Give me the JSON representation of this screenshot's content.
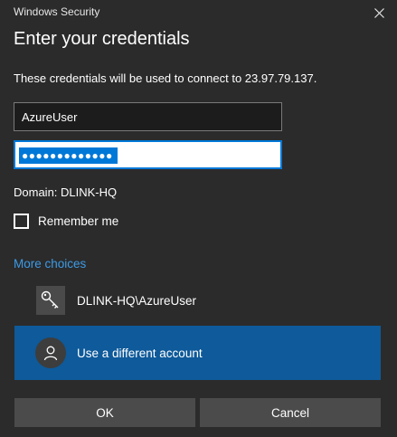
{
  "window": {
    "app_title": "Windows Security",
    "close_glyph": "✕"
  },
  "dialog": {
    "heading": "Enter your credentials",
    "message": "These credentials will be used to connect to 23.97.79.137."
  },
  "form": {
    "username_value": "AzureUser",
    "password_masked": "●●●●●●●●●●●●●",
    "domain_text": "Domain: DLINK-HQ",
    "remember_label": "Remember me",
    "remember_checked": false
  },
  "more_choices_label": "More choices",
  "accounts": [
    {
      "label": "DLINK-HQ\\AzureUser",
      "icon": "key-icon"
    },
    {
      "label": "Use a different account",
      "icon": "user-avatar-icon",
      "selected": true
    }
  ],
  "buttons": {
    "ok": "OK",
    "cancel": "Cancel"
  },
  "colors": {
    "background": "#2b2b2b",
    "accent": "#0078d7",
    "link": "#3c9be6",
    "selected_row": "#0e5a9a",
    "button": "#4b4b4b"
  }
}
